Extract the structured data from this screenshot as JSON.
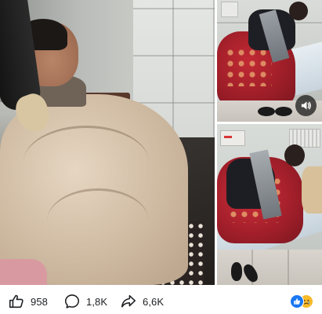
{
  "post": {
    "media": {
      "main_photo_alt": "",
      "top_right_photo_alt": "",
      "bottom_right_photo_alt": "",
      "sound_button_icon": "speaker-icon"
    },
    "stats": {
      "likes": "958",
      "comments": "1,8K",
      "shares": "6,6K"
    },
    "icons": {
      "like": "thumbs-up-icon",
      "comment": "speech-bubble-icon",
      "share": "share-arrow-icon",
      "reactions": [
        "like-reaction-icon",
        "sad-reaction-icon"
      ]
    },
    "colors": {
      "text": "#1c1e21",
      "icon_stroke": "#1c1e21",
      "like_reaction": "#1877f2",
      "sad_reaction": "#f7b928",
      "sound_button_bg": "#141414"
    }
  }
}
